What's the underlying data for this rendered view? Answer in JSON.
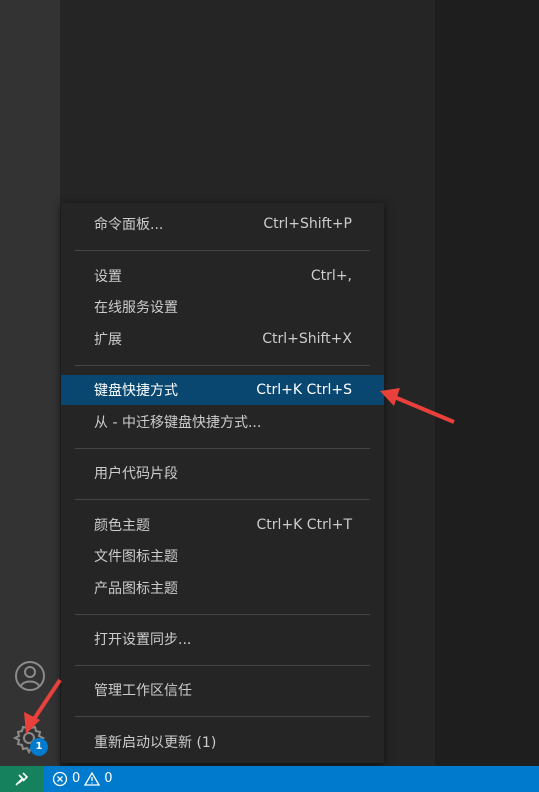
{
  "menu": {
    "items": [
      {
        "label": "命令面板...",
        "keybinding": "Ctrl+Shift+P"
      },
      {
        "label": "设置",
        "keybinding": "Ctrl+,"
      },
      {
        "label": "在线服务设置",
        "keybinding": ""
      },
      {
        "label": "扩展",
        "keybinding": "Ctrl+Shift+X"
      },
      {
        "label": "键盘快捷方式",
        "keybinding": "Ctrl+K Ctrl+S"
      },
      {
        "label": "从 - 中迁移键盘快捷方式...",
        "keybinding": ""
      },
      {
        "label": "用户代码片段",
        "keybinding": ""
      },
      {
        "label": "颜色主题",
        "keybinding": "Ctrl+K Ctrl+T"
      },
      {
        "label": "文件图标主题",
        "keybinding": ""
      },
      {
        "label": "产品图标主题",
        "keybinding": ""
      },
      {
        "label": "打开设置同步...",
        "keybinding": ""
      },
      {
        "label": "管理工作区信任",
        "keybinding": ""
      },
      {
        "label": "重新启动以更新 (1)",
        "keybinding": ""
      }
    ],
    "selected_label": "键盘快捷方式"
  },
  "activity_bar": {
    "manage_badge": "1",
    "icons": [
      "account-icon",
      "gear-icon"
    ]
  },
  "status_bar": {
    "errors": "0",
    "warnings": "0",
    "icons": [
      "remote-icon",
      "error-icon",
      "warning-icon"
    ]
  },
  "colors": {
    "selection": "#094771",
    "status_bar": "#007acc",
    "remote": "#16825d",
    "annotation_arrow": "#e8403a"
  }
}
